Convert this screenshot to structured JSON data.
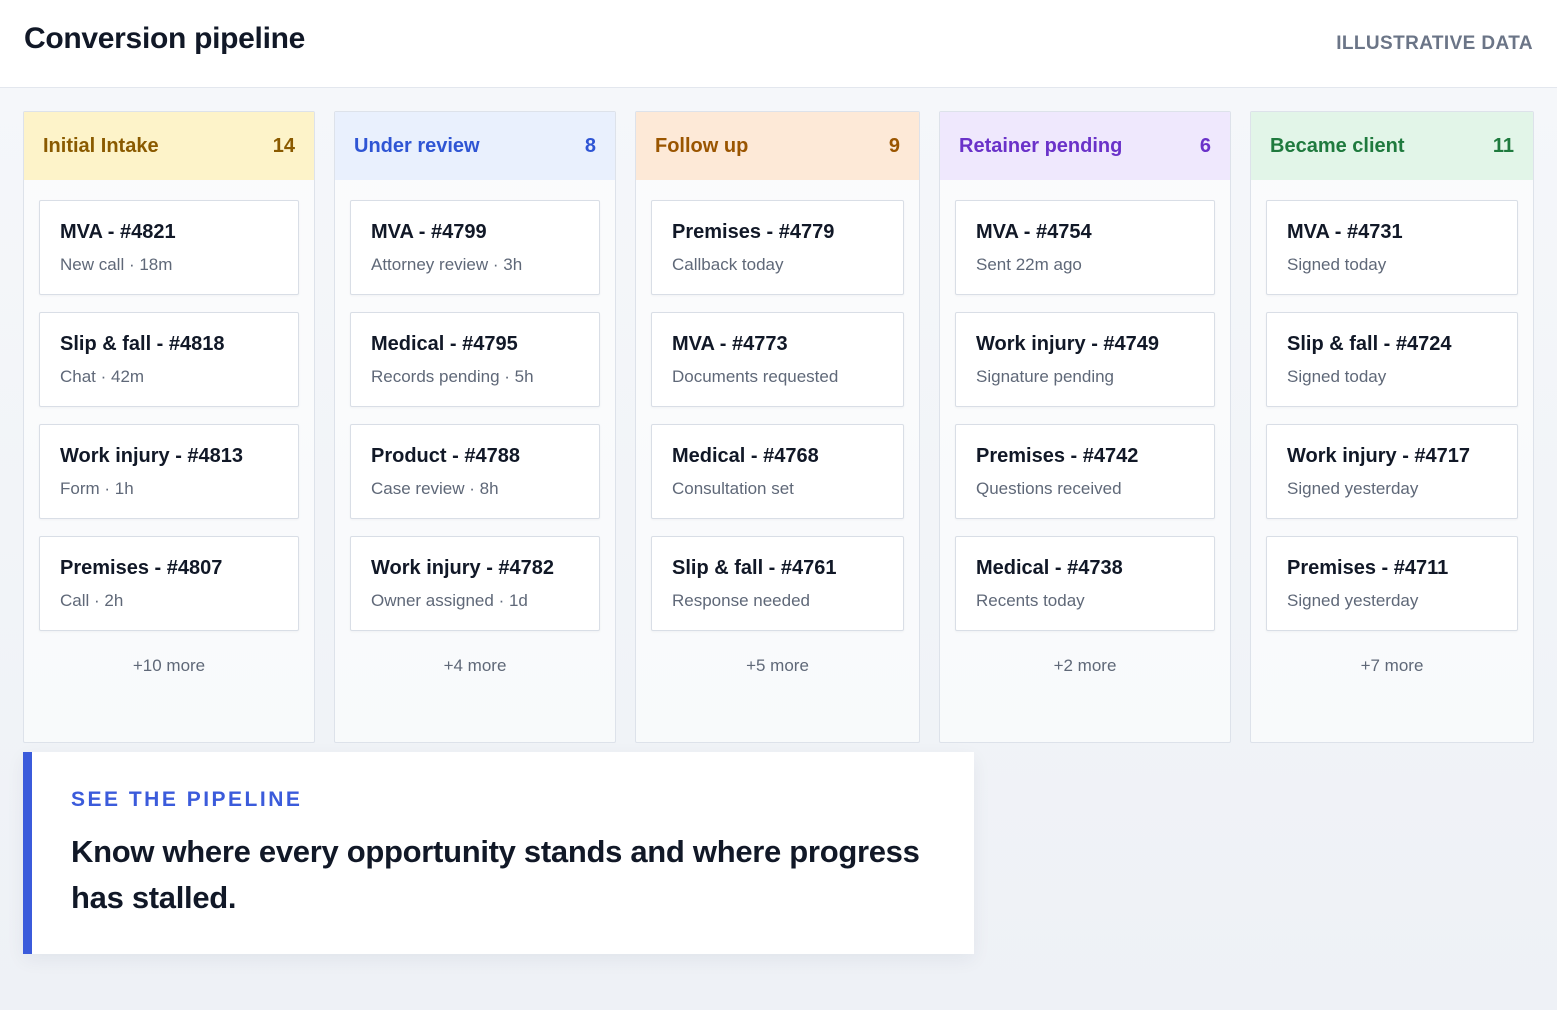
{
  "header": {
    "title": "Conversion pipeline",
    "badge": "ILLUSTRATIVE DATA"
  },
  "colors": {
    "accent": "#3b5bdb"
  },
  "columns": [
    {
      "name": "Initial Intake",
      "count": "14",
      "header_bg": "#fdf3c9",
      "header_fg": "#8a5a00",
      "cards": [
        {
          "title": "MVA - #4821",
          "sub": "New call · 18m"
        },
        {
          "title": "Slip & fall - #4818",
          "sub": "Chat · 42m"
        },
        {
          "title": "Work injury - #4813",
          "sub": "Form · 1h"
        },
        {
          "title": "Premises - #4807",
          "sub": "Call · 2h"
        }
      ],
      "more": "+10 more"
    },
    {
      "name": "Under review",
      "count": "8",
      "header_bg": "#e9f0fd",
      "header_fg": "#2f55d4",
      "cards": [
        {
          "title": "MVA - #4799",
          "sub": "Attorney review · 3h"
        },
        {
          "title": "Medical - #4795",
          "sub": "Records pending · 5h"
        },
        {
          "title": "Product - #4788",
          "sub": "Case review · 8h"
        },
        {
          "title": "Work injury - #4782",
          "sub": "Owner assigned · 1d"
        }
      ],
      "more": "+4 more"
    },
    {
      "name": "Follow up",
      "count": "9",
      "header_bg": "#fde9d7",
      "header_fg": "#9a5500",
      "cards": [
        {
          "title": "Premises - #4779",
          "sub": "Callback today"
        },
        {
          "title": "MVA - #4773",
          "sub": "Documents requested"
        },
        {
          "title": "Medical - #4768",
          "sub": "Consultation set"
        },
        {
          "title": "Slip & fall - #4761",
          "sub": "Response needed"
        }
      ],
      "more": "+5 more"
    },
    {
      "name": "Retainer pending",
      "count": "6",
      "header_bg": "#efe8fd",
      "header_fg": "#6a32c9",
      "cards": [
        {
          "title": "MVA - #4754",
          "sub": "Sent 22m ago"
        },
        {
          "title": "Work injury - #4749",
          "sub": "Signature pending"
        },
        {
          "title": "Premises - #4742",
          "sub": "Questions received"
        },
        {
          "title": "Medical - #4738",
          "sub": "Recents today"
        }
      ],
      "more": "+2 more"
    },
    {
      "name": "Became client",
      "count": "11",
      "header_bg": "#e2f5e8",
      "header_fg": "#1f7a3e",
      "cards": [
        {
          "title": "MVA - #4731",
          "sub": "Signed today"
        },
        {
          "title": "Slip & fall - #4724",
          "sub": "Signed today"
        },
        {
          "title": "Work injury - #4717",
          "sub": "Signed yesterday"
        },
        {
          "title": "Premises - #4711",
          "sub": "Signed yesterday"
        }
      ],
      "more": "+7 more"
    }
  ],
  "callout": {
    "eyebrow": "SEE THE PIPELINE",
    "text": "Know where every opportunity stands and where progress has stalled."
  }
}
